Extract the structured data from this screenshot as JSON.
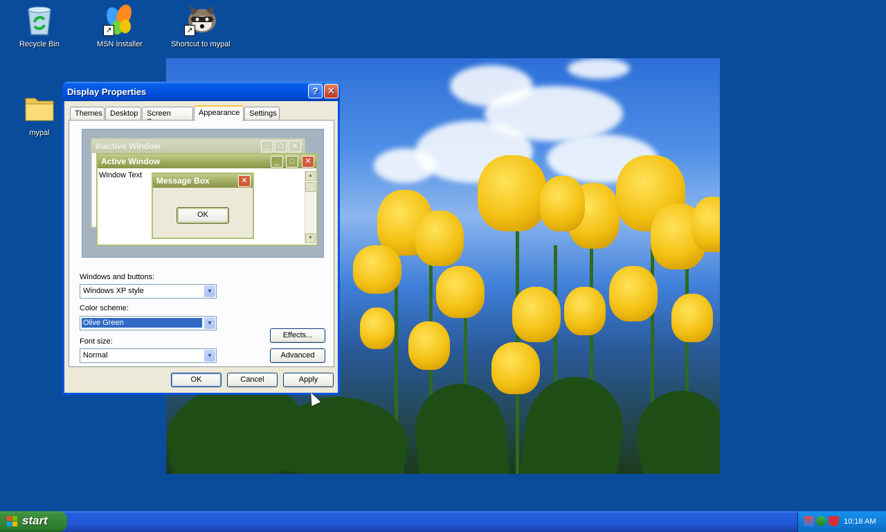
{
  "desktop": {
    "icons": [
      {
        "label": "Recycle Bin",
        "icon": "recycle-bin-icon"
      },
      {
        "label": "MSN Installer",
        "icon": "msn-butterfly-icon"
      },
      {
        "label": "Shortcut to mypal",
        "icon": "mypal-raccoon-icon"
      },
      {
        "label": "mypal",
        "icon": "folder-icon"
      }
    ]
  },
  "window": {
    "title": "Display Properties",
    "tabs": [
      "Themes",
      "Desktop",
      "Screen Saver",
      "Appearance",
      "Settings"
    ],
    "active_tab": "Appearance",
    "preview": {
      "inactive_title": "Inactive Window",
      "active_title": "Active Window",
      "window_text": "Window Text",
      "message_title": "Message Box",
      "ok_label": "OK"
    },
    "windows_buttons": {
      "label": "Windows and buttons:",
      "value": "Windows XP style"
    },
    "color_scheme": {
      "label": "Color scheme:",
      "value": "Olive Green"
    },
    "font_size": {
      "label": "Font size:",
      "value": "Normal"
    },
    "effects_label": "Effects...",
    "advanced_label": "Advanced",
    "ok_label": "OK",
    "cancel_label": "Cancel",
    "apply_label": "Apply"
  },
  "taskbar": {
    "start_label": "start",
    "clock": "10:18 AM"
  },
  "colors": {
    "desktop": "#0a4c9c",
    "olive_title": "#a6b46a",
    "xp_blue": "#0054e3"
  }
}
